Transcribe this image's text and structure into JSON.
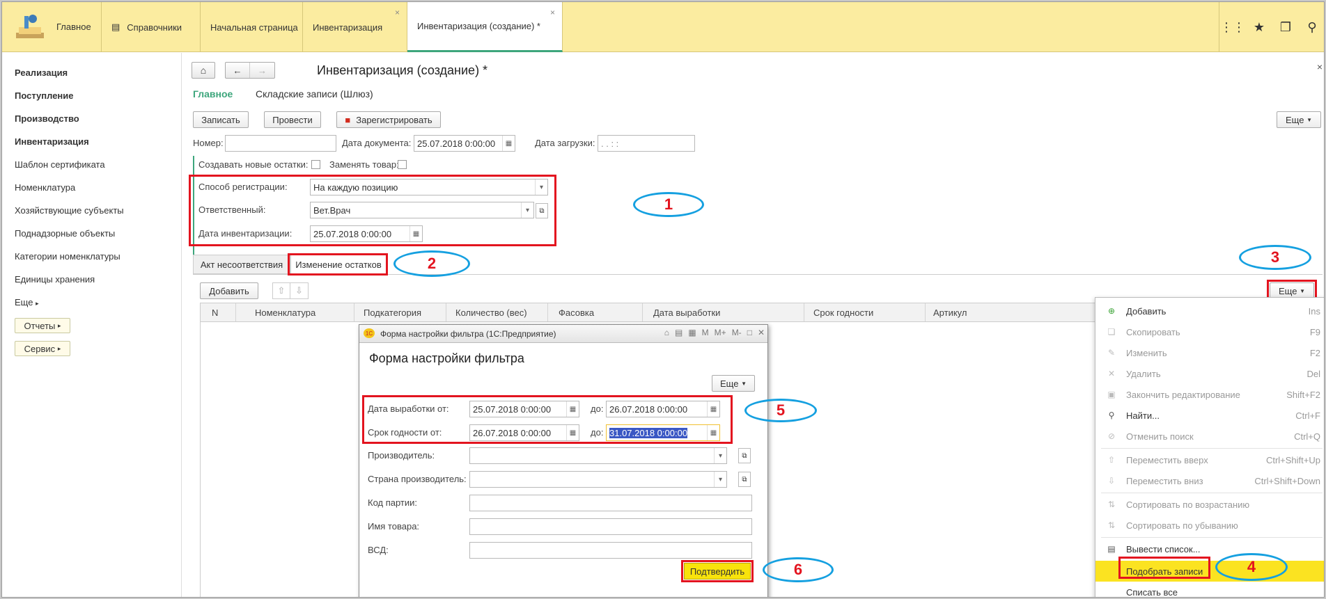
{
  "topbar": {
    "home_label": "Главное",
    "tabs": [
      {
        "label": "Справочники"
      },
      {
        "label": "Начальная страница"
      },
      {
        "label": "Инвентаризация",
        "close": "×"
      },
      {
        "label": "Инвентаризация (создание) *",
        "close": "×"
      }
    ],
    "icons": [
      "apps-grid-icon",
      "star-icon",
      "history-icon",
      "search-icon"
    ]
  },
  "sidebar": {
    "items": [
      {
        "label": "Реализация"
      },
      {
        "label": "Поступление"
      },
      {
        "label": "Производство"
      },
      {
        "label": "Инвентаризация"
      },
      {
        "label": "Шаблон сертификата"
      },
      {
        "label": "Номенклатура"
      },
      {
        "label": "Хозяйствующие субъекты"
      },
      {
        "label": "Поднадзорные объекты"
      },
      {
        "label": "Категории номенклатуры"
      },
      {
        "label": "Единицы хранения"
      },
      {
        "label": "Еще"
      }
    ],
    "buttons": [
      "Отчеты",
      "Сервис"
    ]
  },
  "document": {
    "title": "Инвентаризация (создание) *",
    "close": "×",
    "subtabs": [
      "Главное",
      "Складские записи (Шлюз)"
    ],
    "buttons": {
      "save": "Записать",
      "post": "Провести",
      "register": "Зарегистрировать",
      "more": "Еще"
    },
    "fields": {
      "number_label": "Номер:",
      "number_value": "",
      "doc_date_label": "Дата документа:",
      "doc_date_value": "25.07.2018  0:00:00",
      "load_date_label": "Дата загрузки:",
      "load_date_value": " .  .      :  :",
      "create_new_label": "Создавать новые остатки:",
      "replace_goods_label": "Заменять товар:",
      "reg_method_label": "Способ регистрации:",
      "reg_method_value": "На каждую позицию",
      "responsible_label": "Ответственный:",
      "responsible_value": "Вет.Врач",
      "inv_date_label": "Дата инвентаризации:",
      "inv_date_value": "25.07.2018  0:00:00"
    },
    "tabs": [
      "Акт несоответствия",
      "Изменение остатков"
    ],
    "table_buttons": {
      "add": "Добавить",
      "more": "Еще"
    },
    "columns": [
      "N",
      "Номенклатура",
      "Подкатегория",
      "Количество (вес)",
      "Фасовка",
      "Дата выработки",
      "Срок годности",
      "Артикул"
    ]
  },
  "modal": {
    "window_title": "Форма настройки фильтра  (1С:Предприятие)",
    "heading": "Форма настройки фильтра",
    "more": "Еще",
    "prod_from_label": "Дата выработки от:",
    "prod_from_value": "25.07.2018  0:00:00",
    "prod_to_label": "до:",
    "prod_to_value": "26.07.2018  0:00:00",
    "exp_from_label": "Срок годности от:",
    "exp_from_value": "26.07.2018  0:00:00",
    "exp_to_label": "до:",
    "exp_to_value": "31.07.2018  0:00:00",
    "producer_label": "Производитель:",
    "country_label": "Страна производитель:",
    "batch_label": "Код партии:",
    "goods_name_label": "Имя товара:",
    "vsd_label": "ВСД:",
    "confirm": "Подтвердить",
    "title_icons": [
      "M",
      "M+",
      "M-"
    ]
  },
  "menu": {
    "items": [
      {
        "label": "Добавить",
        "key": "Ins",
        "disabled": false
      },
      {
        "label": "Скопировать",
        "key": "F9",
        "disabled": true
      },
      {
        "label": "Изменить",
        "key": "F2",
        "disabled": true
      },
      {
        "label": "Удалить",
        "key": "Del",
        "disabled": true
      },
      {
        "label": "Закончить редактирование",
        "key": "Shift+F2",
        "disabled": true
      },
      {
        "label": "Найти...",
        "key": "Ctrl+F",
        "disabled": false
      },
      {
        "label": "Отменить поиск",
        "key": "Ctrl+Q",
        "disabled": true
      },
      {
        "label": "Переместить вверх",
        "key": "Ctrl+Shift+Up",
        "disabled": true
      },
      {
        "label": "Переместить вниз",
        "key": "Ctrl+Shift+Down",
        "disabled": true
      },
      {
        "label": "Сортировать по возрастанию",
        "key": "",
        "disabled": true
      },
      {
        "label": "Сортировать по убыванию",
        "key": "",
        "disabled": true
      },
      {
        "label": "Вывести список...",
        "key": "",
        "disabled": false
      },
      {
        "label": "Подобрать записи",
        "key": "",
        "disabled": false
      },
      {
        "label": "Списать все",
        "key": "",
        "disabled": false
      }
    ]
  },
  "annotations": [
    "1",
    "2",
    "3",
    "4",
    "5",
    "6"
  ],
  "colors": {
    "topbar": "#fbeca0",
    "accent_green": "#3da67c",
    "highlight_yellow": "#fbe321",
    "annotation_red": "#e3141f",
    "annotation_blue": "#15a0e0"
  }
}
